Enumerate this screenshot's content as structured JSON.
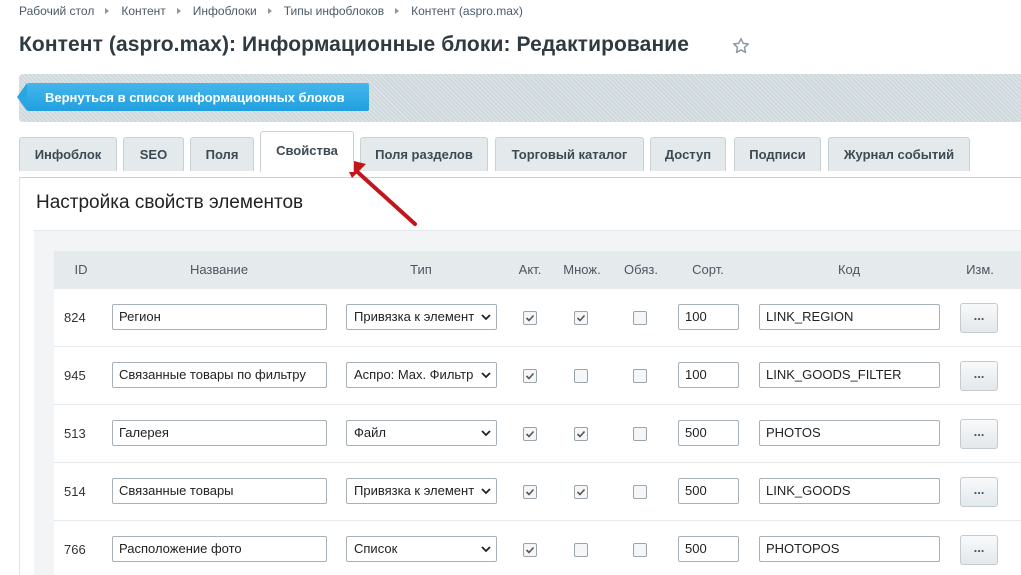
{
  "breadcrumb": [
    "Рабочий стол",
    "Контент",
    "Инфоблоки",
    "Типы инфоблоков",
    "Контент (aspro.max)"
  ],
  "page_title": "Контент (aspro.max): Информационные блоки: Редактирование",
  "toolbar": {
    "back_label": "Вернуться в список информационных блоков"
  },
  "tabs": [
    "Инфоблок",
    "SEO",
    "Поля",
    "Свойства",
    "Поля разделов",
    "Торговый каталог",
    "Доступ",
    "Подписи",
    "Журнал событий"
  ],
  "active_tab": "Свойства",
  "section_title": "Настройка свойств элементов",
  "table": {
    "headers": {
      "id": "ID",
      "name": "Название",
      "type": "Тип",
      "active": "Акт.",
      "multiple": "Множ.",
      "required": "Обяз.",
      "sort": "Сорт.",
      "code": "Код",
      "edit": "Изм."
    },
    "edit_label": "...",
    "rows": [
      {
        "id": "824",
        "name": "Регион",
        "type": "Привязка к элемент",
        "active": true,
        "multiple": true,
        "required": false,
        "sort": "100",
        "code": "LINK_REGION"
      },
      {
        "id": "945",
        "name": "Связанные товары по фильтру",
        "type": "Аспро: Max. Фильтр",
        "active": true,
        "multiple": false,
        "required": false,
        "sort": "100",
        "code": "LINK_GOODS_FILTER"
      },
      {
        "id": "513",
        "name": "Галерея",
        "type": "Файл",
        "active": true,
        "multiple": true,
        "required": false,
        "sort": "500",
        "code": "PHOTOS"
      },
      {
        "id": "514",
        "name": "Связанные товары",
        "type": "Привязка к элемент",
        "active": true,
        "multiple": true,
        "required": false,
        "sort": "500",
        "code": "LINK_GOODS"
      },
      {
        "id": "766",
        "name": "Расположение фото",
        "type": "Список",
        "active": true,
        "multiple": false,
        "required": false,
        "sort": "500",
        "code": "PHOTOPOS"
      }
    ]
  },
  "colors": {
    "accent": "#20a0de",
    "arrow": "#c0161c"
  }
}
